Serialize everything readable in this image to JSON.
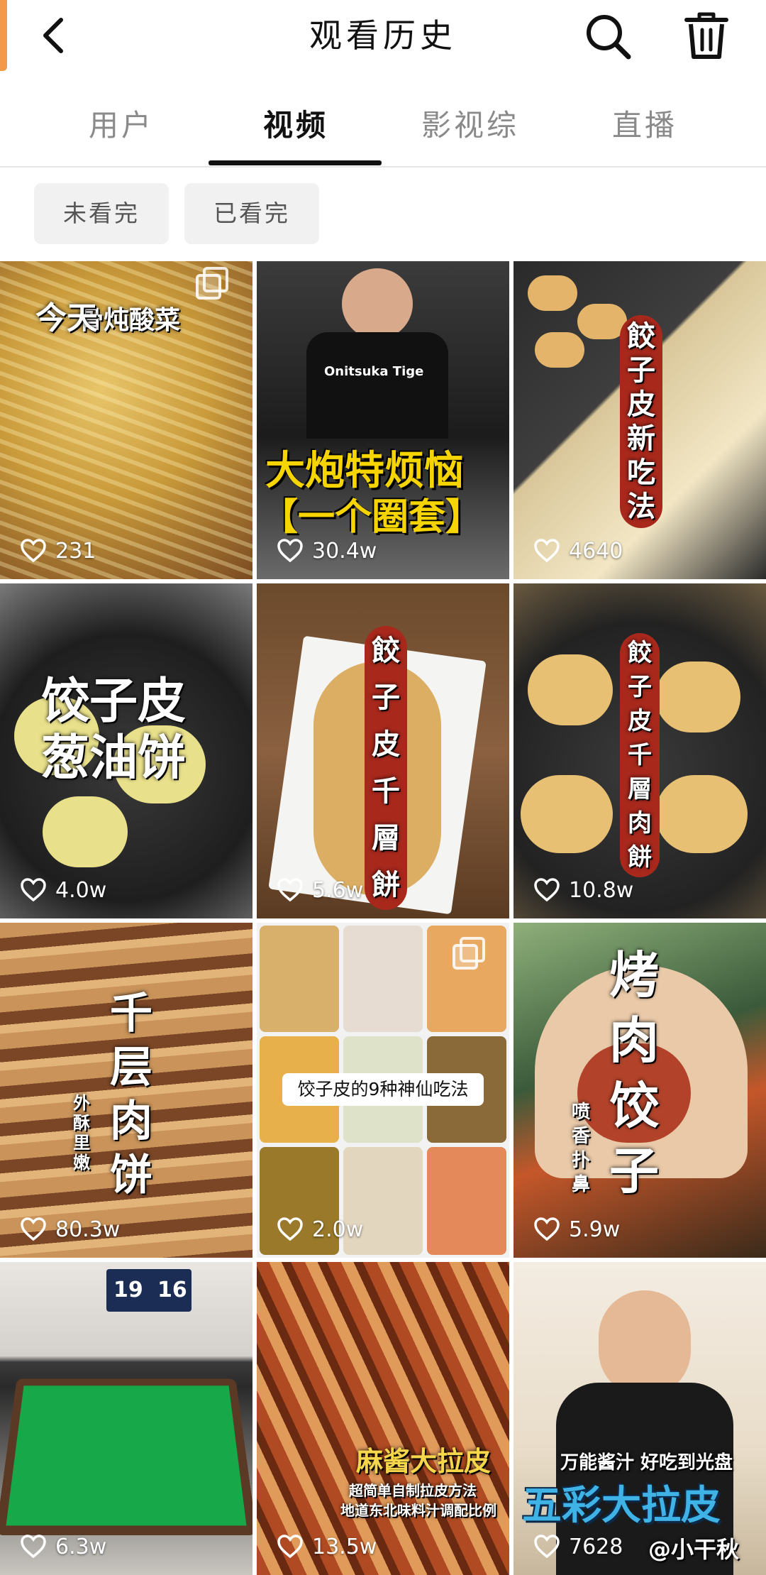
{
  "header": {
    "title": "观看历史",
    "back_icon": "chevron-left-icon",
    "search_icon": "search-icon",
    "delete_icon": "trash-icon"
  },
  "tabs": [
    {
      "label": "用户",
      "active": false
    },
    {
      "label": "视频",
      "active": true
    },
    {
      "label": "影视综",
      "active": false
    },
    {
      "label": "直播",
      "active": false
    }
  ],
  "filters": [
    {
      "label": "未看完"
    },
    {
      "label": "已看完"
    }
  ],
  "videos": [
    {
      "likes": "231",
      "overlay": "今天",
      "caption": "骨炖酸菜"
    },
    {
      "likes": "30.4w",
      "caption_line1": "大炮特烦恼",
      "caption_line2": "【一个圈套】",
      "shirt": "Onitsuka Tige"
    },
    {
      "likes": "4640",
      "caption": "餃子皮新吃法"
    },
    {
      "likes": "4.0w",
      "caption_line1": "饺子皮",
      "caption_line2": "葱油饼"
    },
    {
      "likes": "5.6w",
      "caption": "餃子皮千層餅"
    },
    {
      "likes": "10.8w",
      "caption": "餃子皮千層肉餅"
    },
    {
      "likes": "80.3w",
      "caption": "千层肉饼",
      "sub": "外酥里嫩"
    },
    {
      "likes": "2.0w",
      "caption": "饺子皮的9种神仙吃法"
    },
    {
      "likes": "5.9w",
      "caption": "烤肉饺子",
      "sub": "喷香扑鼻"
    },
    {
      "likes": "6.3w",
      "score1": "19",
      "score2": "16"
    },
    {
      "likes": "13.5w",
      "caption": "麻酱大拉皮",
      "sub_line1": "超简单自制拉皮方法",
      "sub_line2": "地道东北味料汁调配比例"
    },
    {
      "likes": "7628",
      "caption_top": "万能酱汁  好吃到光盘",
      "caption": "五彩大拉皮",
      "watermark": "@小干秋"
    }
  ],
  "colors": {
    "accent_orange": "#f2994a",
    "active_tab": "#111111",
    "inactive_tab": "#8a8a8a",
    "chip_bg": "#f1f1f1"
  }
}
